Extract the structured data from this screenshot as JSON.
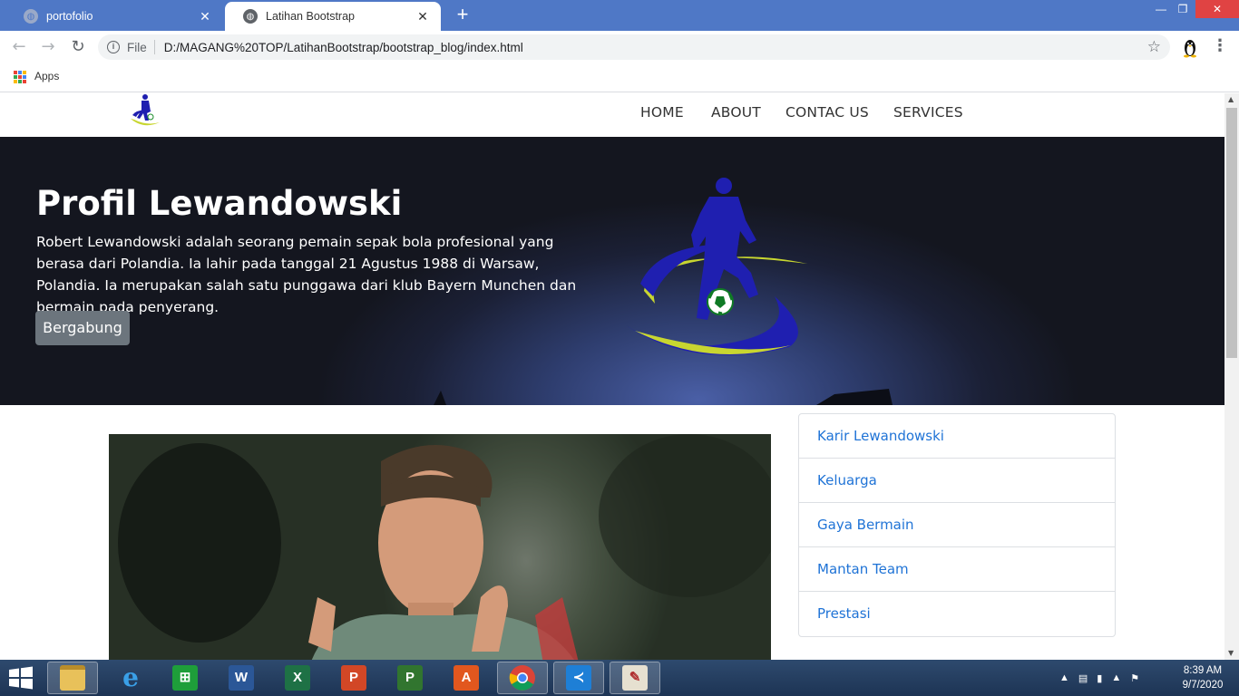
{
  "browser": {
    "tabs": [
      {
        "title": "portofolio",
        "close": "✕"
      },
      {
        "title": "Latihan Bootstrap",
        "close": "✕"
      }
    ],
    "new_tab": "+",
    "window_controls": {
      "minimize": "—",
      "maximize": "❐",
      "close": "✕"
    },
    "address": {
      "scheme_label": "File",
      "url": "D:/MAGANG%20TOP/LatihanBootstrap/bootstrap_blog/index.html"
    },
    "bookmarks_bar": {
      "apps_label": "Apps"
    }
  },
  "site": {
    "nav": {
      "links": [
        "HOME",
        "ABOUT",
        "CONTAC US",
        "SERVICES"
      ]
    },
    "hero": {
      "title": "Profil Lewandowski",
      "text": "Robert Lewandowski adalah seorang pemain sepak bola profesional yang berasa dari Polandia. Ia lahir pada tanggal 21 Agustus 1988 di Warsaw, Polandia. Ia merupakan salah satu punggawa dari klub Bayern Munchen dan bermain pada penyerang.",
      "button": "Bergabung"
    },
    "sidebar": {
      "items": [
        "Karir Lewandowski",
        "Keluarga",
        "Gaya Bermain",
        "Mantan Team",
        "Prestasi"
      ]
    },
    "colors": {
      "link": "#1f73d6",
      "button_secondary": "#6c757d",
      "logo_blue": "#1f1fb0",
      "logo_yellow": "#c8d630"
    }
  },
  "taskbar": {
    "apps": [
      "file-explorer-icon",
      "internet-explorer-icon",
      "store-icon",
      "word-icon",
      "excel-icon",
      "powerpoint-icon",
      "project-icon",
      "acrobat-icon",
      "chrome-icon",
      "vscode-icon",
      "paint-icon"
    ],
    "clock": {
      "time": "8:39 AM",
      "date": "9/7/2020"
    }
  }
}
